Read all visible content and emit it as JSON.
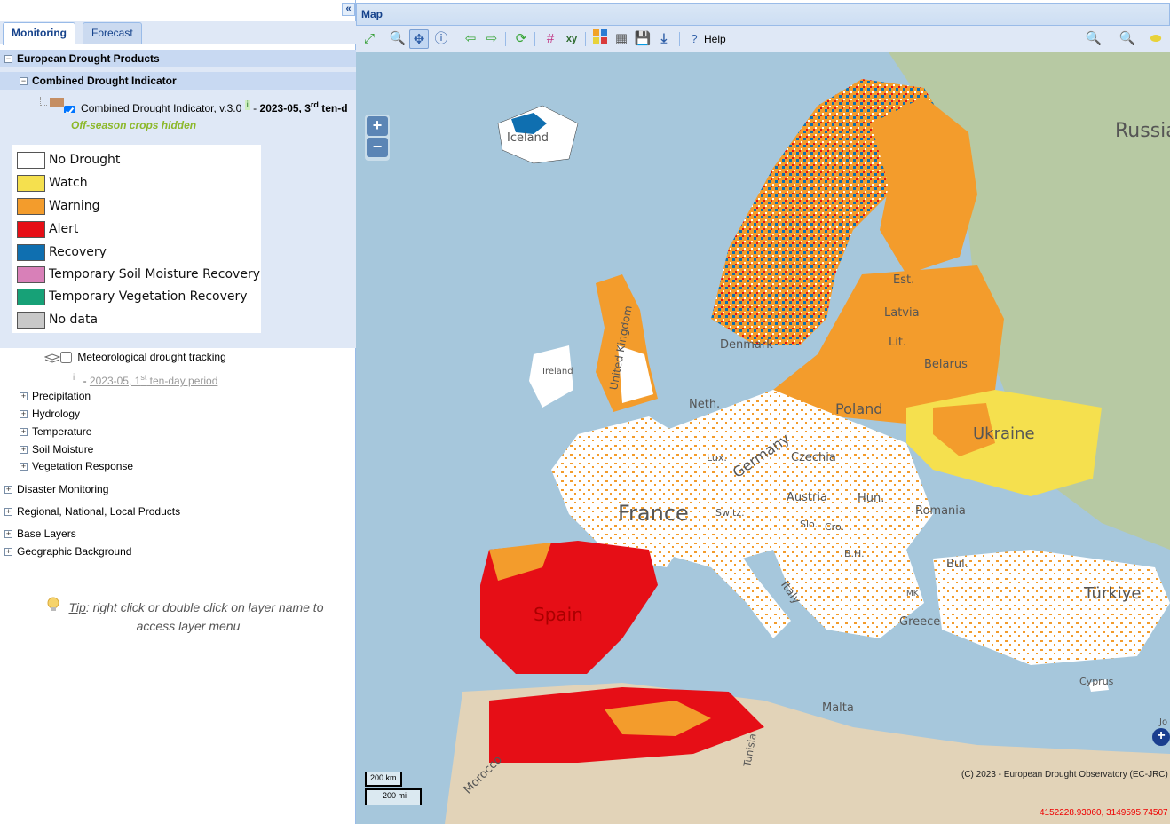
{
  "tabs": [
    "Monitoring",
    "Forecast"
  ],
  "tree": {
    "group1": "European Drought Products",
    "subgroup": "Combined Drought Indicator",
    "layer_name": "Combined Drought Indicator, v.3.0",
    "layer_info": "i",
    "layer_sep": "-",
    "layer_date": "2023-05, 3",
    "layer_date_sup": "rd",
    "layer_date_tail": " ten-d",
    "offseason": "Off-season crops hidden",
    "met_layer": "Meteorological drought tracking",
    "met_info": "i",
    "met_sep": "-",
    "met_date": "2023-05, 1",
    "met_date_sup": "st",
    "met_date_tail": " ten-day period",
    "children": [
      "Precipitation",
      "Hydrology",
      "Temperature",
      "Soil Moisture",
      "Vegetation Response"
    ],
    "top_groups": [
      "Disaster Monitoring",
      "Regional, National, Local Products",
      "Base Layers",
      "Geographic Background"
    ]
  },
  "legend": [
    {
      "label": "No Drought",
      "color": "#ffffff"
    },
    {
      "label": "Watch",
      "color": "#f5e04e"
    },
    {
      "label": "Warning",
      "color": "#f39c2c"
    },
    {
      "label": "Alert",
      "color": "#e60e16"
    },
    {
      "label": "Recovery",
      "color": "#0f6fb0"
    },
    {
      "label": "Temporary Soil Moisture Recovery",
      "color": "#d880b8"
    },
    {
      "label": "Temporary Vegetation Recovery",
      "color": "#17a177"
    },
    {
      "label": "No data",
      "color": "#c8c8c8"
    }
  ],
  "tip": {
    "prefix": "Tip",
    "text": ": right click or double click on layer name to access layer menu"
  },
  "map": {
    "title": "Map",
    "help": "Help",
    "zoom_in": "+",
    "zoom_out": "−",
    "scale_km": "200 km",
    "scale_mi": "200 mi",
    "copyright": "(C) 2023 - European Drought Observatory (EC-JRC)",
    "coords": "4152228.93060, 3149595.74507",
    "labels": {
      "russia": "Russia",
      "iceland": "Iceland",
      "est": "Est.",
      "latvia": "Latvia",
      "lit": "Lit.",
      "belarus": "Belarus",
      "ukraine": "Ukraine",
      "poland": "Poland",
      "germany": "Germany",
      "czechia": "Czechia",
      "denmark": "Denmark",
      "neth": "Neth.",
      "lux": "Lux.",
      "france": "France",
      "switz": "Switz.",
      "austria": "Austria",
      "hun": "Hun.",
      "romania": "Romania",
      "slo": "Slo.",
      "cro": "Cro.",
      "bh": "B.H.",
      "bul": "Bul.",
      "mk": "MK",
      "greece": "Greece",
      "turkiye": "Türkiye",
      "italy": "Italy",
      "spain": "Spain",
      "malta": "Malta",
      "cyprus": "Cyprus",
      "tunisia": "Tunisia",
      "morocco": "Morocco",
      "uk": "United Kingdom",
      "ireland": "Ireland",
      "jo": "Jo"
    }
  }
}
